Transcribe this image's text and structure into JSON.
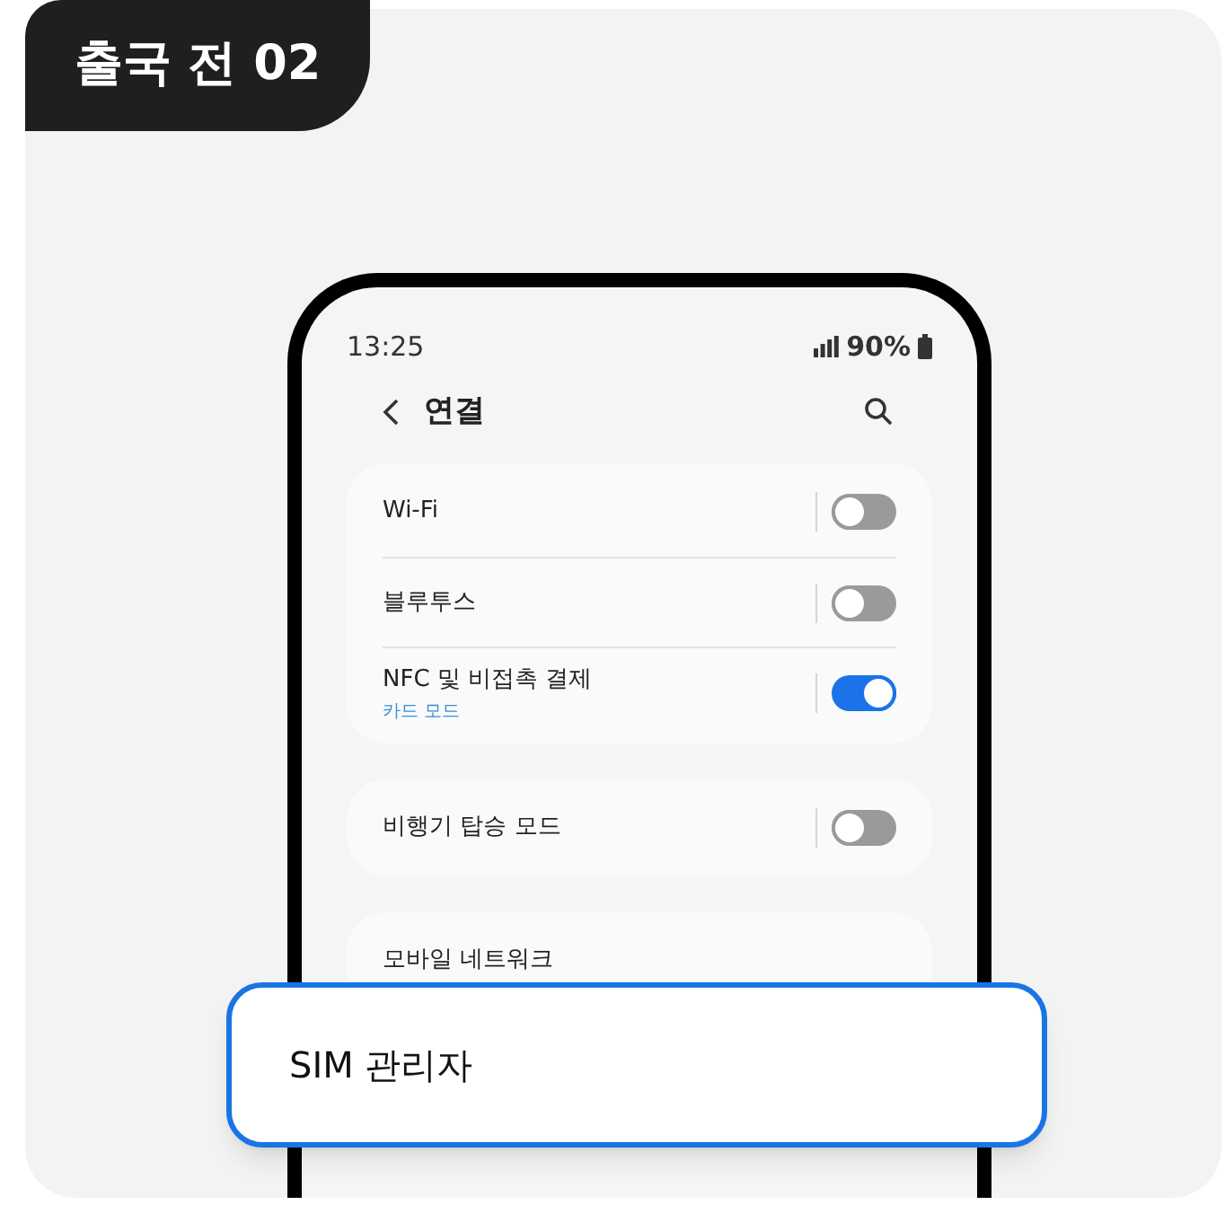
{
  "badge": "출국 전 02",
  "status_bar": {
    "time": "13:25",
    "battery": "90%"
  },
  "header": {
    "title": "연결"
  },
  "groups": [
    {
      "items": [
        {
          "kind": "toggle",
          "label": "Wi-Fi",
          "on": false
        },
        {
          "kind": "toggle",
          "label": "블루투스",
          "on": false
        },
        {
          "kind": "toggle",
          "label": "NFC 및 비접촉 결제",
          "sublabel": "카드 모드",
          "on": true
        }
      ]
    },
    {
      "items": [
        {
          "kind": "toggle",
          "label": "비행기 탑승 모드",
          "on": false
        }
      ]
    },
    {
      "items": [
        {
          "kind": "link",
          "label": "모바일 네트워크"
        }
      ]
    }
  ],
  "callout": {
    "label": "SIM 관리자"
  }
}
